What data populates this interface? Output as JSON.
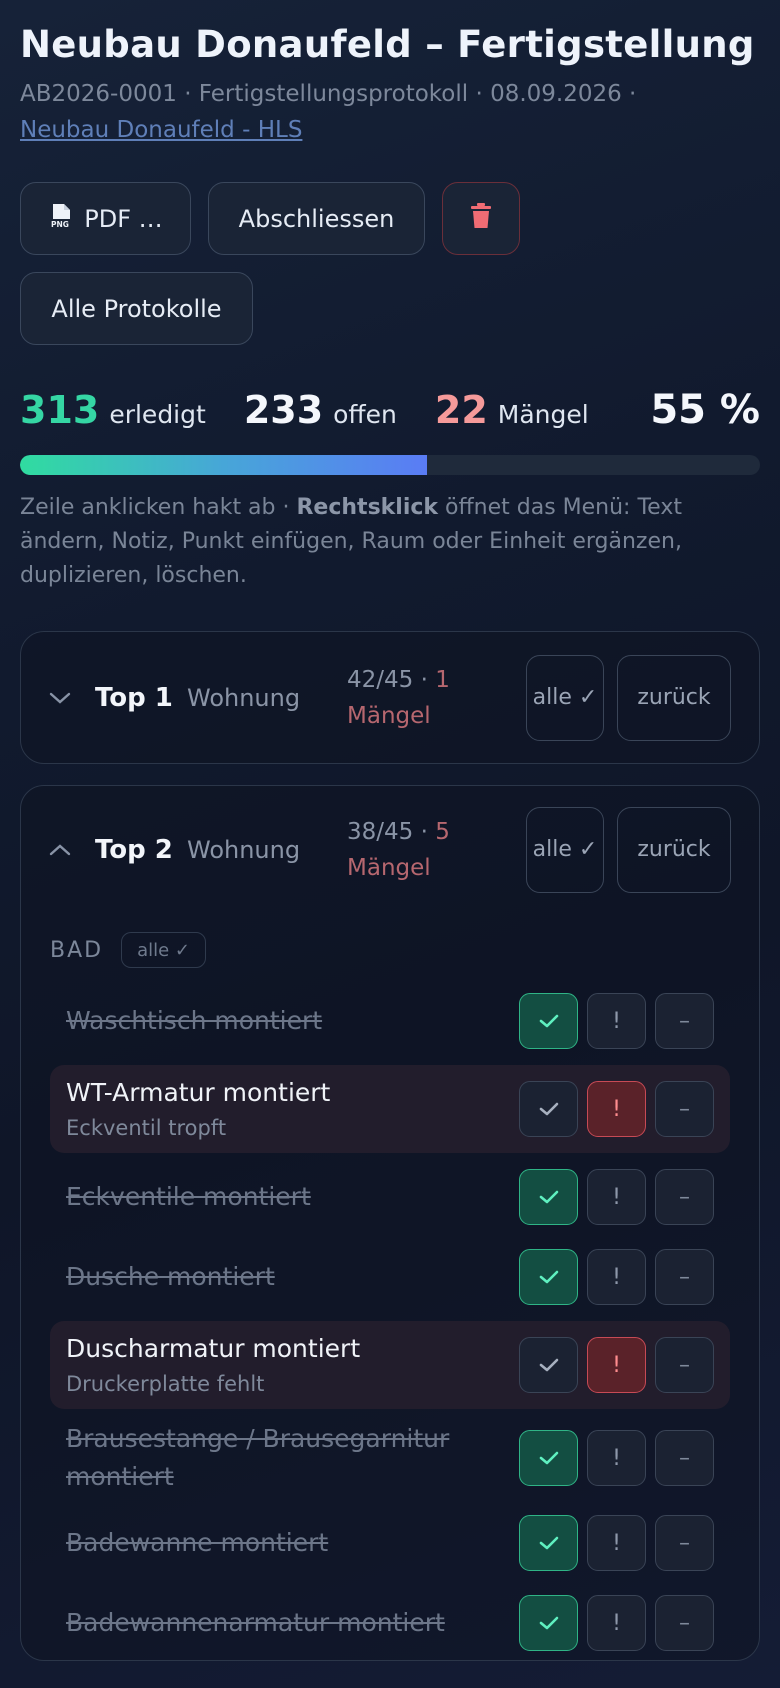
{
  "header": {
    "title": "Neubau Donaufeld – Fertigstellung",
    "meta_text": "AB2026-0001 · Fertigstellungsprotokoll · 08.09.2026 ·",
    "project_link": "Neubau Donaufeld - HLS"
  },
  "actions": {
    "pdf_label": "PDF …",
    "close_label": "Abschliessen",
    "delete_icon": "trash-icon",
    "all_protocols_label": "Alle Protokolle"
  },
  "stats": {
    "done_count": "313",
    "done_label": "erledigt",
    "open_count": "233",
    "open_label": "offen",
    "defect_count": "22",
    "defect_label": "Mängel",
    "percent": "55 %",
    "progress_fraction": 0.55
  },
  "hint": {
    "part1": "Zeile anklicken hakt ab · ",
    "bold": "Rechtsklick",
    "part2": " öffnet das Menü: Text ändern, Notiz, Punkt einfügen, Raum oder Einheit ergänzen, duplizieren, löschen."
  },
  "units": [
    {
      "title": "Top 1",
      "type": "Wohnung",
      "count": "42/45 · ",
      "defects": "1 Mängel",
      "all_label": "alle ✓",
      "back_label": "zurück",
      "expanded": false
    },
    {
      "title": "Top 2",
      "type": "Wohnung",
      "count": "38/45 · ",
      "defects": "5 Mängel",
      "all_label": "alle ✓",
      "back_label": "zurück",
      "expanded": true,
      "section": {
        "name": "BAD",
        "all_label": "alle ✓",
        "items": [
          {
            "text": "Waschtisch montiert",
            "note": "",
            "status": "done"
          },
          {
            "text": "WT-Armatur montiert",
            "note": "Eckventil tropft",
            "status": "defect"
          },
          {
            "text": "Eckventile montiert",
            "note": "",
            "status": "done"
          },
          {
            "text": "Dusche montiert",
            "note": "",
            "status": "done"
          },
          {
            "text": "Duscharmatur montiert",
            "note": "Druckerplatte fehlt",
            "status": "defect"
          },
          {
            "text": "Brausestange / Brausegarnitur montiert",
            "note": "",
            "status": "done"
          },
          {
            "text": "Badewanne montiert",
            "note": "",
            "status": "done"
          },
          {
            "text": "Badewannenarmatur montiert",
            "note": "",
            "status": "done"
          }
        ]
      }
    }
  ],
  "toggle_labels": {
    "warn": "!",
    "na": "–"
  }
}
